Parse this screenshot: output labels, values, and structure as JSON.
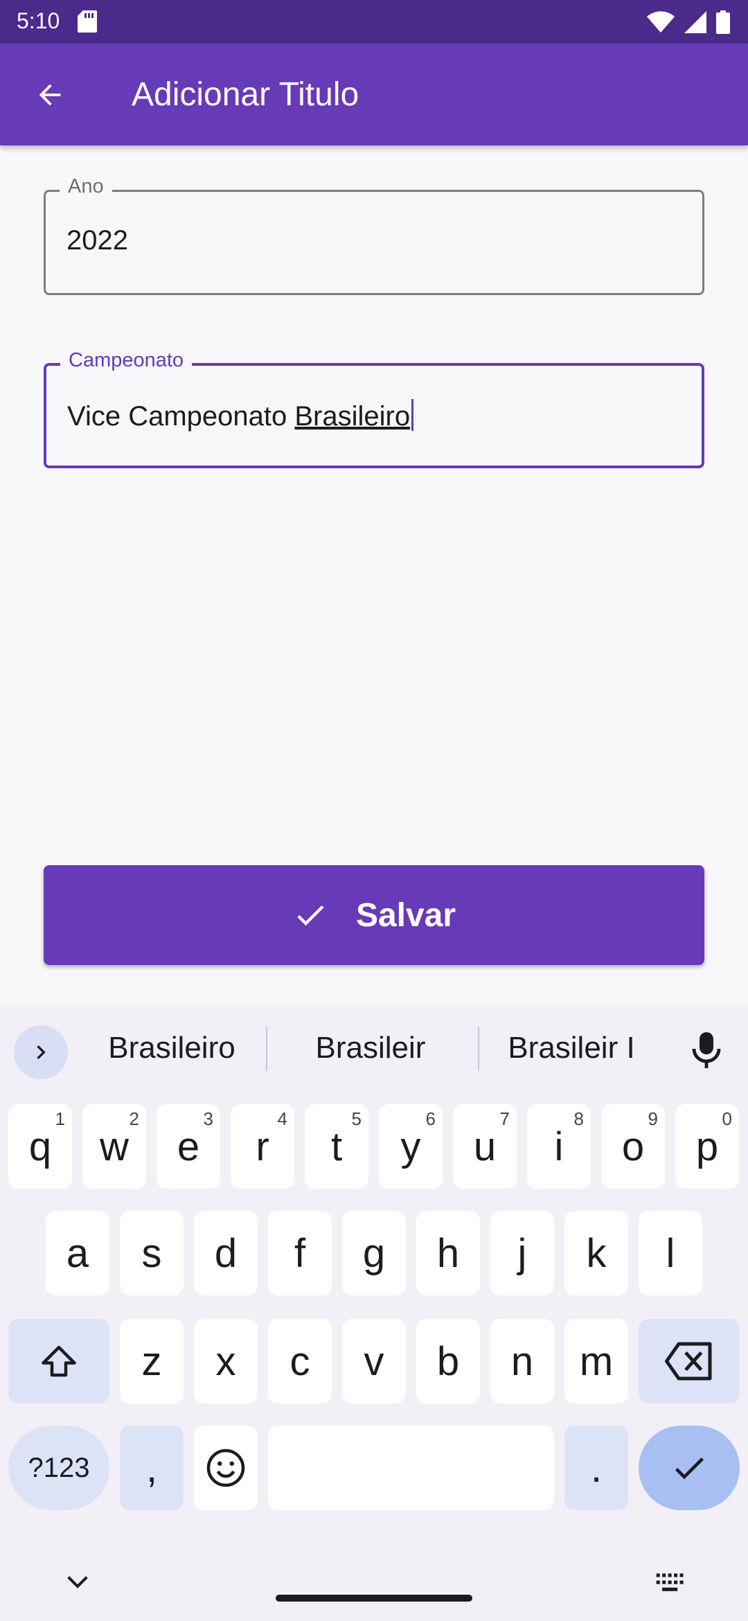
{
  "status_bar": {
    "time": "5:10"
  },
  "app_bar": {
    "title": "Adicionar Titulo"
  },
  "form": {
    "ano": {
      "label": "Ano",
      "value": "2022"
    },
    "campeonato": {
      "label": "Campeonato",
      "value_prefix": "Vice Campeonato ",
      "value_composing": "Brasileiro"
    }
  },
  "save_button": {
    "label": "Salvar"
  },
  "keyboard": {
    "suggestions": [
      "Brasileiro",
      "Brasileir",
      "Brasileir I"
    ],
    "row1": [
      {
        "k": "q",
        "n": "1"
      },
      {
        "k": "w",
        "n": "2"
      },
      {
        "k": "e",
        "n": "3"
      },
      {
        "k": "r",
        "n": "4"
      },
      {
        "k": "t",
        "n": "5"
      },
      {
        "k": "y",
        "n": "6"
      },
      {
        "k": "u",
        "n": "7"
      },
      {
        "k": "i",
        "n": "8"
      },
      {
        "k": "o",
        "n": "9"
      },
      {
        "k": "p",
        "n": "0"
      }
    ],
    "row2": [
      "a",
      "s",
      "d",
      "f",
      "g",
      "h",
      "j",
      "k",
      "l"
    ],
    "row3": [
      "z",
      "x",
      "c",
      "v",
      "b",
      "n",
      "m"
    ],
    "symbols_label": "?123",
    "comma": ",",
    "period": "."
  },
  "colors": {
    "primary": "#673ab7",
    "status_bar": "#4a2a8a",
    "key_mod": "#dde3f6"
  }
}
